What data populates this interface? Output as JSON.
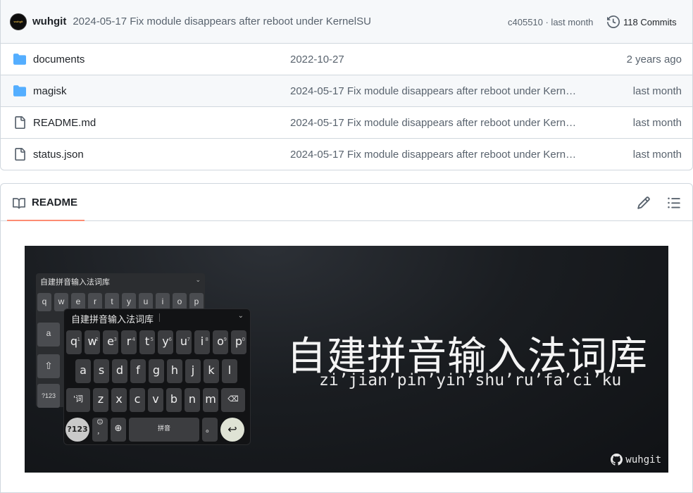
{
  "commit": {
    "author": "wuhgit",
    "avatar_text": "wuhgit",
    "message": "2024-05-17 Fix module disappears after reboot under KernelSU",
    "meta": "c405510 · last month",
    "commits_label": "118 Commits"
  },
  "files": [
    {
      "name": "documents",
      "type": "folder",
      "message": "2022-10-27",
      "date": "2 years ago"
    },
    {
      "name": "magisk",
      "type": "folder",
      "message": "2024-05-17 Fix module disappears after reboot under Kern…",
      "date": "last month"
    },
    {
      "name": "README.md",
      "type": "file",
      "message": "2024-05-17 Fix module disappears after reboot under Kern…",
      "date": "last month"
    },
    {
      "name": "status.json",
      "type": "file",
      "message": "2024-05-17 Fix module disappears after reboot under Kern…",
      "date": "last month"
    }
  ],
  "readme": {
    "tab_label": "README",
    "banner": {
      "title": "自建拼音输入法词库",
      "subtitle": "zi’jian’pin’yin’shu’ru’fa’ci’ku",
      "brand": "wuhgit",
      "keyboard_bar": "自建拼音输入法词库",
      "row1": [
        "q",
        "w",
        "e",
        "r",
        "t",
        "y",
        "u",
        "i",
        "o",
        "p"
      ],
      "row1_nums": [
        "1",
        "2",
        "3",
        "4",
        "5",
        "6",
        "7",
        "8",
        "9",
        "0"
      ],
      "row2": [
        "a",
        "s",
        "d",
        "f",
        "g",
        "h",
        "j",
        "k",
        "l"
      ],
      "row3": [
        "z",
        "x",
        "c",
        "v",
        "b",
        "n",
        "m"
      ],
      "key_ci": "'词",
      "key_123": "?123",
      "key_space": "拼音",
      "key_period": "。",
      "key_comma": "，",
      "key_emoji": "☺",
      "back_row": [
        "q",
        "w",
        "e",
        "r",
        "t",
        "y",
        "u",
        "i",
        "o",
        "p"
      ],
      "back_a": "a",
      "back_123": "?123"
    }
  },
  "colors": {
    "accent": "#fd8c73",
    "folder": "#54aeff",
    "muted": "#59636e"
  },
  "icons": {
    "folder": "folder-icon",
    "file": "file-icon",
    "history": "history-icon",
    "book": "book-icon",
    "pencil": "pencil-icon",
    "list": "list-icon"
  }
}
